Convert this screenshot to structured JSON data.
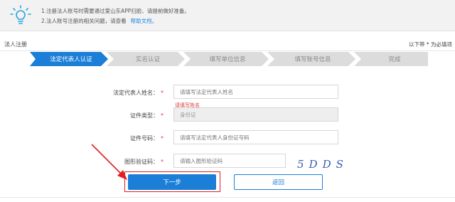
{
  "notice": {
    "line1": "1.注册法人账号时需要通过爱山东APP扫脸、请提前做好准备。",
    "line2": "2.法人账号注册的相关问题，请查看",
    "help_link": "帮助文档。"
  },
  "header": {
    "title": "法人注册",
    "required_note": "以下带 * 为必填项"
  },
  "steps": [
    {
      "label": "法定代表人认证",
      "active": true
    },
    {
      "label": "实名认证",
      "active": false
    },
    {
      "label": "填写单位信息",
      "active": false
    },
    {
      "label": "填写账号信息",
      "active": false
    },
    {
      "label": "完成",
      "active": false
    }
  ],
  "form": {
    "name_label": "法定代表人姓名：",
    "name_placeholder": "请填写法定代表人姓名",
    "name_error": "请填写姓名",
    "id_type_label": "证件类型：",
    "id_type_value": "身份证",
    "id_number_label": "证件号码：",
    "id_number_placeholder": "请填写法定代表人身份证号码",
    "captcha_label": "图形验证码：",
    "captcha_placeholder": "请输入图形验证码",
    "captcha_text": "5DDS",
    "required_mark": "*"
  },
  "buttons": {
    "next": "下一步",
    "back": "返回"
  },
  "colors": {
    "accent": "#1b7fd8",
    "step_active": "#1b7fd8",
    "step_inactive": "#dcdcdc",
    "error": "#e23c3c",
    "highlight": "#e02020"
  }
}
